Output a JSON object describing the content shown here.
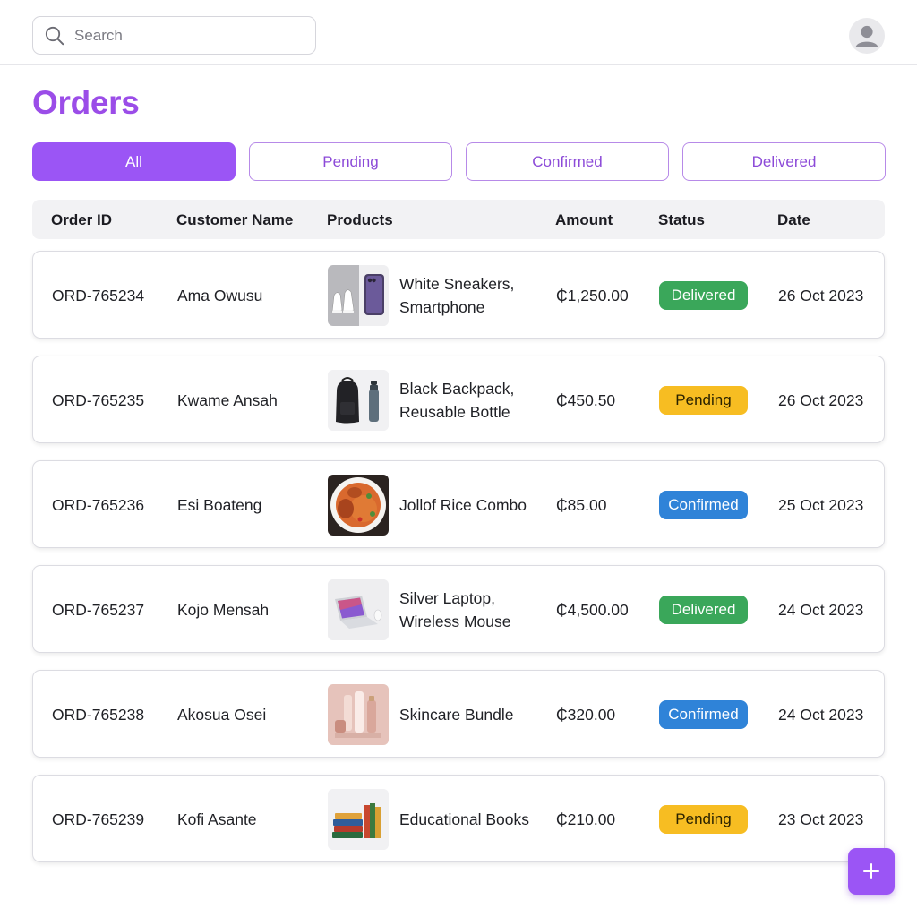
{
  "search": {
    "placeholder": "Search",
    "value": ""
  },
  "page": {
    "title": "Orders"
  },
  "tabs": [
    {
      "label": "All",
      "active": true
    },
    {
      "label": "Pending",
      "active": false
    },
    {
      "label": "Confirmed",
      "active": false
    },
    {
      "label": "Delivered",
      "active": false
    }
  ],
  "table": {
    "columns": [
      "Order ID",
      "Customer Name",
      "Products",
      "Amount",
      "Status",
      "Date"
    ],
    "rows": [
      {
        "id": "ORD-765234",
        "customer": "Ama Owusu",
        "products_line1": "White Sneakers,",
        "products_line2": "Smartphone",
        "thumbnail": "sneakers-smartphone-image",
        "amount": "₵1,250.00",
        "status": "Delivered",
        "status_kind": "delivered",
        "date": "26 Oct 2023"
      },
      {
        "id": "ORD-765235",
        "customer": "Kwame Ansah",
        "products_line1": "Black Backpack,",
        "products_line2": "Reusable Bottle",
        "thumbnail": "backpack-bottle-image",
        "amount": "₵450.50",
        "status": "Pending",
        "status_kind": "pending",
        "date": "26 Oct 2023"
      },
      {
        "id": "ORD-765236",
        "customer": "Esi Boateng",
        "products_line1": "Jollof Rice Combo",
        "products_line2": "",
        "thumbnail": "jollof-rice-image",
        "amount": "₵85.00",
        "status": "Confirmed",
        "status_kind": "confirmed",
        "date": "25 Oct 2023"
      },
      {
        "id": "ORD-765237",
        "customer": "Kojo Mensah",
        "products_line1": "Silver Laptop,",
        "products_line2": "Wireless Mouse",
        "thumbnail": "laptop-mouse-image",
        "amount": "₵4,500.00",
        "status": "Delivered",
        "status_kind": "delivered",
        "date": "24 Oct 2023"
      },
      {
        "id": "ORD-765238",
        "customer": "Akosua Osei",
        "products_line1": "Skincare Bundle",
        "products_line2": "",
        "thumbnail": "skincare-image",
        "amount": "₵320.00",
        "status": "Confirmed",
        "status_kind": "confirmed",
        "date": "24 Oct 2023"
      },
      {
        "id": "ORD-765239",
        "customer": "Kofi Asante",
        "products_line1": "Educational Books",
        "products_line2": "",
        "thumbnail": "books-image",
        "amount": "₵210.00",
        "status": "Pending",
        "status_kind": "pending",
        "date": "23 Oct 2023"
      }
    ]
  },
  "icons": {
    "search": "search-icon",
    "avatar": "user-avatar-icon",
    "fab": "plus-icon"
  },
  "colors": {
    "accent": "#9b55f5",
    "title": "#9b4de8",
    "delivered": "#3aa75a",
    "pending": "#f7bd22",
    "confirmed": "#2f83d8"
  }
}
